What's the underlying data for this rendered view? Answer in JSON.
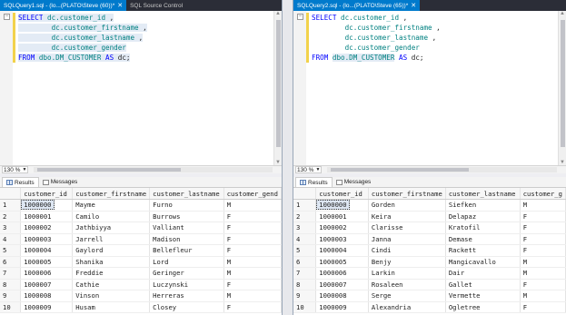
{
  "left": {
    "tabs": [
      {
        "label": "SQLQuery1.sql - (lo...(PLATO\\Steve (60))*",
        "active": true
      },
      {
        "label": "SQL Source Control",
        "active": false
      }
    ],
    "sql": [
      "SELECT",
      "dc.customer_id",
      ",",
      "dc.customer_firstname",
      ",",
      "dc.customer_lastname",
      ",",
      "dc.customer_gender",
      "FROM",
      "dbo.DM_CUSTOMER",
      "AS",
      "dc;"
    ],
    "zoom": "130 %",
    "result_tabs": [
      "Results",
      "Messages"
    ],
    "columns": [
      "customer_id",
      "customer_firstname",
      "customer_lastname",
      "customer_gend"
    ],
    "rows": [
      [
        "1",
        "1000000",
        "Mayme",
        "Furno",
        "M"
      ],
      [
        "2",
        "1000001",
        "Camilo",
        "Burrows",
        "F"
      ],
      [
        "3",
        "1000002",
        "Jathbiyya",
        "Valliant",
        "F"
      ],
      [
        "4",
        "1000003",
        "Jarrell",
        "Madison",
        "F"
      ],
      [
        "5",
        "1000004",
        "Gaylord",
        "Bellefleur",
        "F"
      ],
      [
        "6",
        "1000005",
        "Shanika",
        "Lord",
        "M"
      ],
      [
        "7",
        "1000006",
        "Freddie",
        "Geringer",
        "M"
      ],
      [
        "8",
        "1000007",
        "Cathie",
        "Luczynski",
        "F"
      ],
      [
        "9",
        "1000008",
        "Vinson",
        "Herreras",
        "M"
      ],
      [
        "10",
        "1000009",
        "Husam",
        "Closey",
        "F"
      ]
    ]
  },
  "right": {
    "tabs": [
      {
        "label": "SQLQuery2.sql - (lo...(PLATO\\Steve (65))*",
        "active": true
      }
    ],
    "sql": [
      "SELECT",
      "dc.customer_id",
      ",",
      "dc.customer_firstname",
      ",",
      "dc.customer_lastname",
      ",",
      "dc.customer_gender",
      "FROM",
      "dbo.DM_CUSTOMER",
      "AS",
      "dc;"
    ],
    "zoom": "130 %",
    "result_tabs": [
      "Results",
      "Messages"
    ],
    "columns": [
      "customer_id",
      "customer_firstname",
      "customer_lastname",
      "customer_g"
    ],
    "rows": [
      [
        "1",
        "1000000",
        "Gorden",
        "Siefken",
        "M"
      ],
      [
        "2",
        "1000001",
        "Keira",
        "Delapaz",
        "F"
      ],
      [
        "3",
        "1000002",
        "Clarisse",
        "Kratofil",
        "F"
      ],
      [
        "4",
        "1000003",
        "Janna",
        "Demase",
        "F"
      ],
      [
        "5",
        "1000004",
        "Cindi",
        "Rackett",
        "F"
      ],
      [
        "6",
        "1000005",
        "Benjy",
        "Mangicavallo",
        "M"
      ],
      [
        "7",
        "1000006",
        "Larkin",
        "Dair",
        "M"
      ],
      [
        "8",
        "1000007",
        "Rosaleen",
        "Gallet",
        "F"
      ],
      [
        "9",
        "1000008",
        "Serge",
        "Vermette",
        "M"
      ],
      [
        "10",
        "1000009",
        "Alexandria",
        "Ogletree",
        "F"
      ]
    ]
  }
}
